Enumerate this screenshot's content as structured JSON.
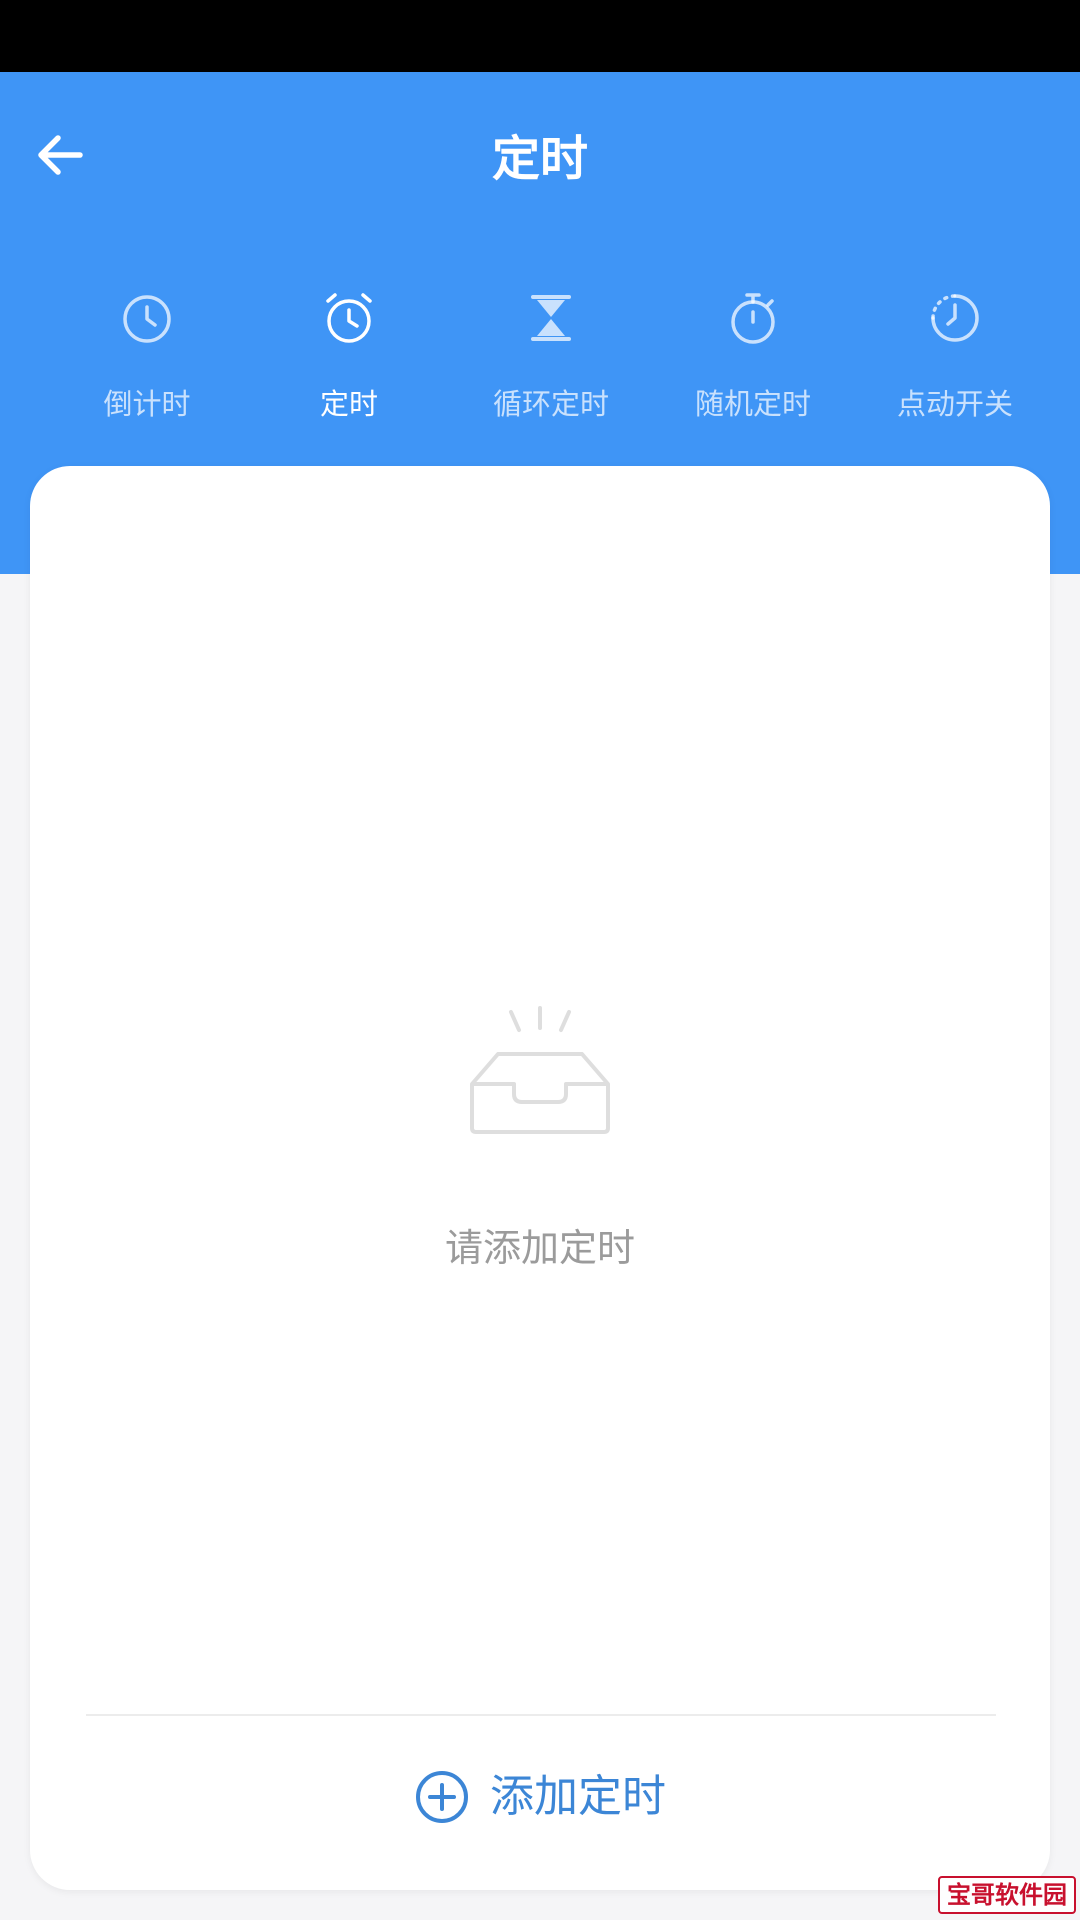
{
  "header": {
    "title": "定时",
    "back_icon": "arrow-left-icon"
  },
  "mode_tabs": [
    {
      "label": "倒计时",
      "icon": "clock-icon",
      "active": false
    },
    {
      "label": "定时",
      "icon": "alarm-clock-icon",
      "active": true
    },
    {
      "label": "循环定时",
      "icon": "hourglass-icon",
      "active": false
    },
    {
      "label": "随机定时",
      "icon": "stopwatch-icon",
      "active": false
    },
    {
      "label": "点动开关",
      "icon": "dotted-clock-icon",
      "active": false
    }
  ],
  "empty_state": {
    "icon": "empty-inbox-icon",
    "message": "请添加定时"
  },
  "add_button": {
    "icon": "plus-circle-icon",
    "label": "添加定时"
  },
  "watermark": {
    "text": "宝哥软件园"
  },
  "colors": {
    "header_bg": "#3f95f6",
    "accent": "#3c86d6",
    "status_bar": "#000000",
    "page_bg": "#f5f5f7",
    "watermark": "#c8102e"
  }
}
